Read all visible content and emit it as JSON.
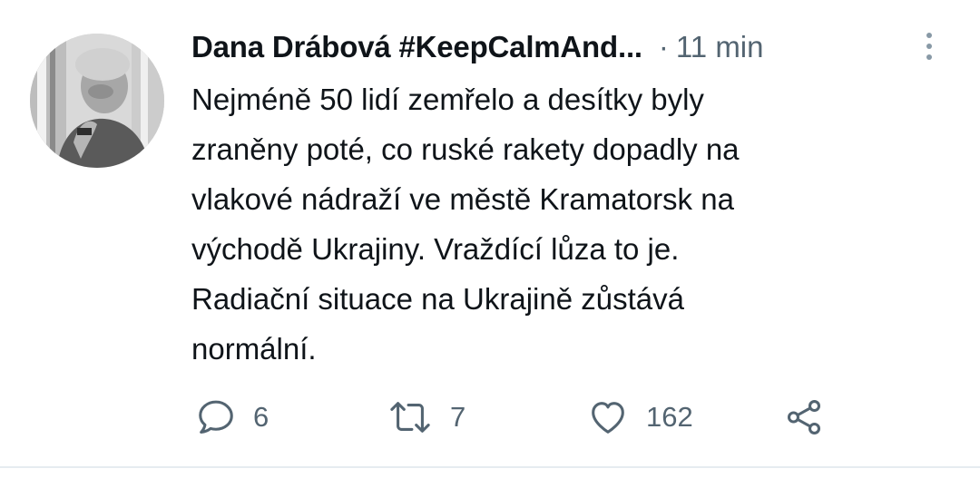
{
  "tweet": {
    "author_name": "Dana Drábová #KeepCalmAnd...",
    "separator": "·",
    "time": "11 min",
    "text_lines": [
      "Nejméně 50 lidí zemřelo a desítky byly",
      "zraněny poté, co ruské rakety dopadly na",
      "vlakové nádraží ve městě Kramatorsk na",
      "východě Ukrajiny. Vraždící lůza to je.",
      "Radiační situace na Ukrajině zůstává",
      "normální."
    ]
  },
  "actions": {
    "reply": {
      "icon": "reply-icon",
      "count": "6"
    },
    "retweet": {
      "icon": "retweet-icon",
      "count": "7"
    },
    "like": {
      "icon": "heart-icon",
      "count": "162"
    },
    "share": {
      "icon": "share-icon"
    }
  },
  "colors": {
    "text": "#0f1419",
    "secondary": "#536471",
    "divider": "#e6ecf0"
  }
}
